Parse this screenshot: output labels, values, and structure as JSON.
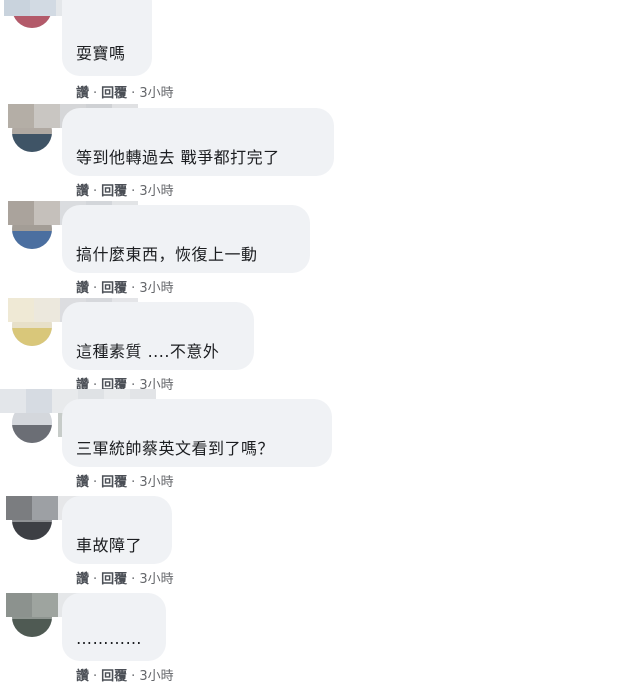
{
  "comments": [
    {
      "text": "耍寶嗎",
      "like": "讚",
      "reply": "回覆",
      "time": "3小時",
      "bubble_width": 90
    },
    {
      "text": "等到他轉過去 戰爭都打完了",
      "like": "讚",
      "reply": "回覆",
      "time": "3小時",
      "bubble_width": 272
    },
    {
      "text": "搞什麼東西，恢復上一動",
      "like": "讚",
      "reply": "回覆",
      "time": "3小時",
      "bubble_width": 248
    },
    {
      "text": "這種素質 ....不意外",
      "like": "讚",
      "reply": "回覆",
      "time": "3小時",
      "bubble_width": 192
    },
    {
      "text": "三軍統帥蔡英文看到了嗎？",
      "like": "讚",
      "reply": "回覆",
      "time": "3小時",
      "bubble_width": 270
    },
    {
      "text": "車故障了",
      "like": "讚",
      "reply": "回覆",
      "time": "3小時",
      "bubble_width": 110
    },
    {
      "text": "…………",
      "like": "讚",
      "reply": "回覆",
      "time": "3小時",
      "bubble_width": 104
    }
  ],
  "colors": {
    "bubble": "#f0f2f5",
    "text": "#1c1e21",
    "meta": "#65676b"
  }
}
